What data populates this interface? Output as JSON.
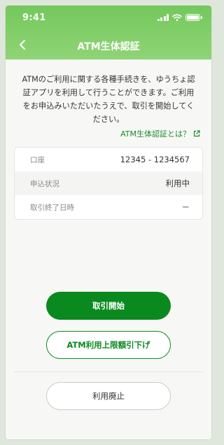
{
  "status_bar": {
    "time": "9:41"
  },
  "nav": {
    "title": "ATM生体認証"
  },
  "intro_text": "ATMのご利用に関する各種手続きを、ゆうちょ認証アプリを利用して行うことができます。ご利用をお申込みいただいたうえで、取引を開始してください。",
  "help_link": {
    "label": "ATM生体認証とは？"
  },
  "info": {
    "rows": [
      {
        "label": "口座",
        "value": "12345 - 1234567"
      },
      {
        "label": "申込状況",
        "value": "利用中"
      },
      {
        "label": "取引終了日時",
        "value": "－"
      }
    ]
  },
  "buttons": {
    "start": "取引開始",
    "lower_limit": "ATM利用上限額引下げ",
    "cancel_usage": "利用廃止"
  },
  "colors": {
    "header": "#74c85c",
    "primary": "#0a8a1e",
    "link": "#1b8a2a"
  }
}
